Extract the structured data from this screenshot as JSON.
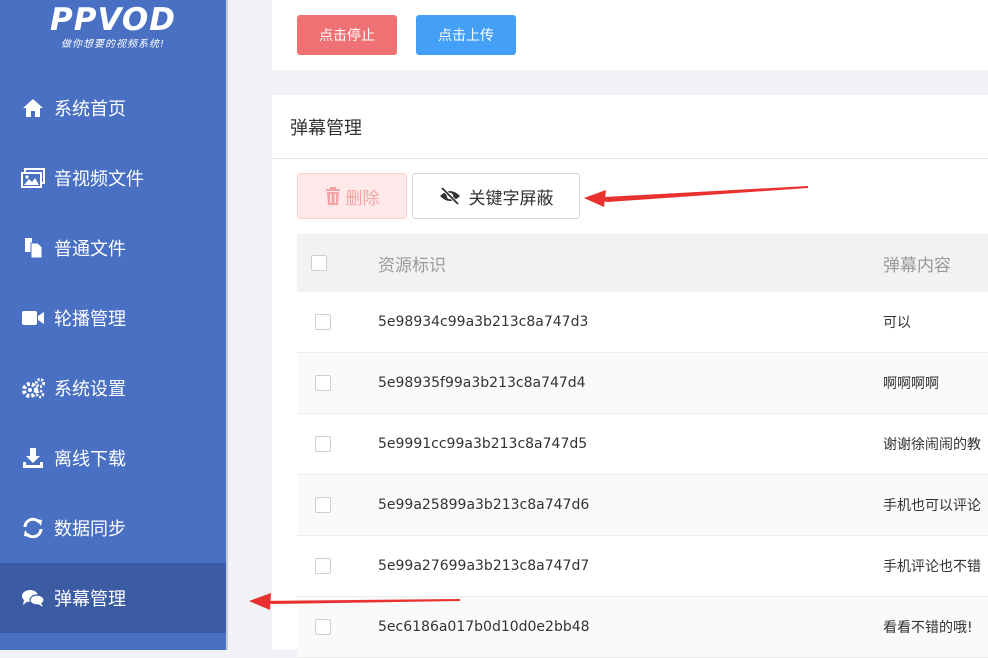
{
  "logo": {
    "title": "PPVOD",
    "subtitle": "做你想要的视频系统!"
  },
  "sidebar": {
    "items": [
      {
        "label": "系统首页",
        "icon": "home-icon"
      },
      {
        "label": "音视频文件",
        "icon": "images-icon"
      },
      {
        "label": "普通文件",
        "icon": "files-icon"
      },
      {
        "label": "轮播管理",
        "icon": "video-camera-icon"
      },
      {
        "label": "系统设置",
        "icon": "gears-icon"
      },
      {
        "label": "离线下载",
        "icon": "download-icon"
      },
      {
        "label": "数据同步",
        "icon": "sync-icon"
      },
      {
        "label": "弹幕管理",
        "icon": "comments-icon",
        "active": true
      }
    ]
  },
  "top_actions": {
    "stop_label": "点击停止",
    "upload_label": "点击上传"
  },
  "panel": {
    "title": "弹幕管理",
    "delete_label": "删除",
    "keyword_block_label": "关键字屏蔽"
  },
  "table": {
    "headers": [
      "资源标识",
      "弹幕内容"
    ],
    "rows": [
      {
        "id": "5e98934c99a3b213c8a747d3",
        "content": "可以"
      },
      {
        "id": "5e98935f99a3b213c8a747d4",
        "content": "啊啊啊啊"
      },
      {
        "id": "5e9991cc99a3b213c8a747d5",
        "content": "谢谢徐闹闹的教"
      },
      {
        "id": "5e99a25899a3b213c8a747d6",
        "content": "手机也可以评论"
      },
      {
        "id": "5e99a27699a3b213c8a747d7",
        "content": "手机评论也不错"
      },
      {
        "id": "5ec6186a017b0d10d0e2bb48",
        "content": "看看不错的哦!"
      }
    ]
  },
  "colors": {
    "sidebar": "#4a70c4",
    "sidebar_active": "#3b5ba3",
    "stop_button": "#f07173",
    "upload_button": "#43a0f6",
    "annotation_arrow": "#e8312f"
  }
}
